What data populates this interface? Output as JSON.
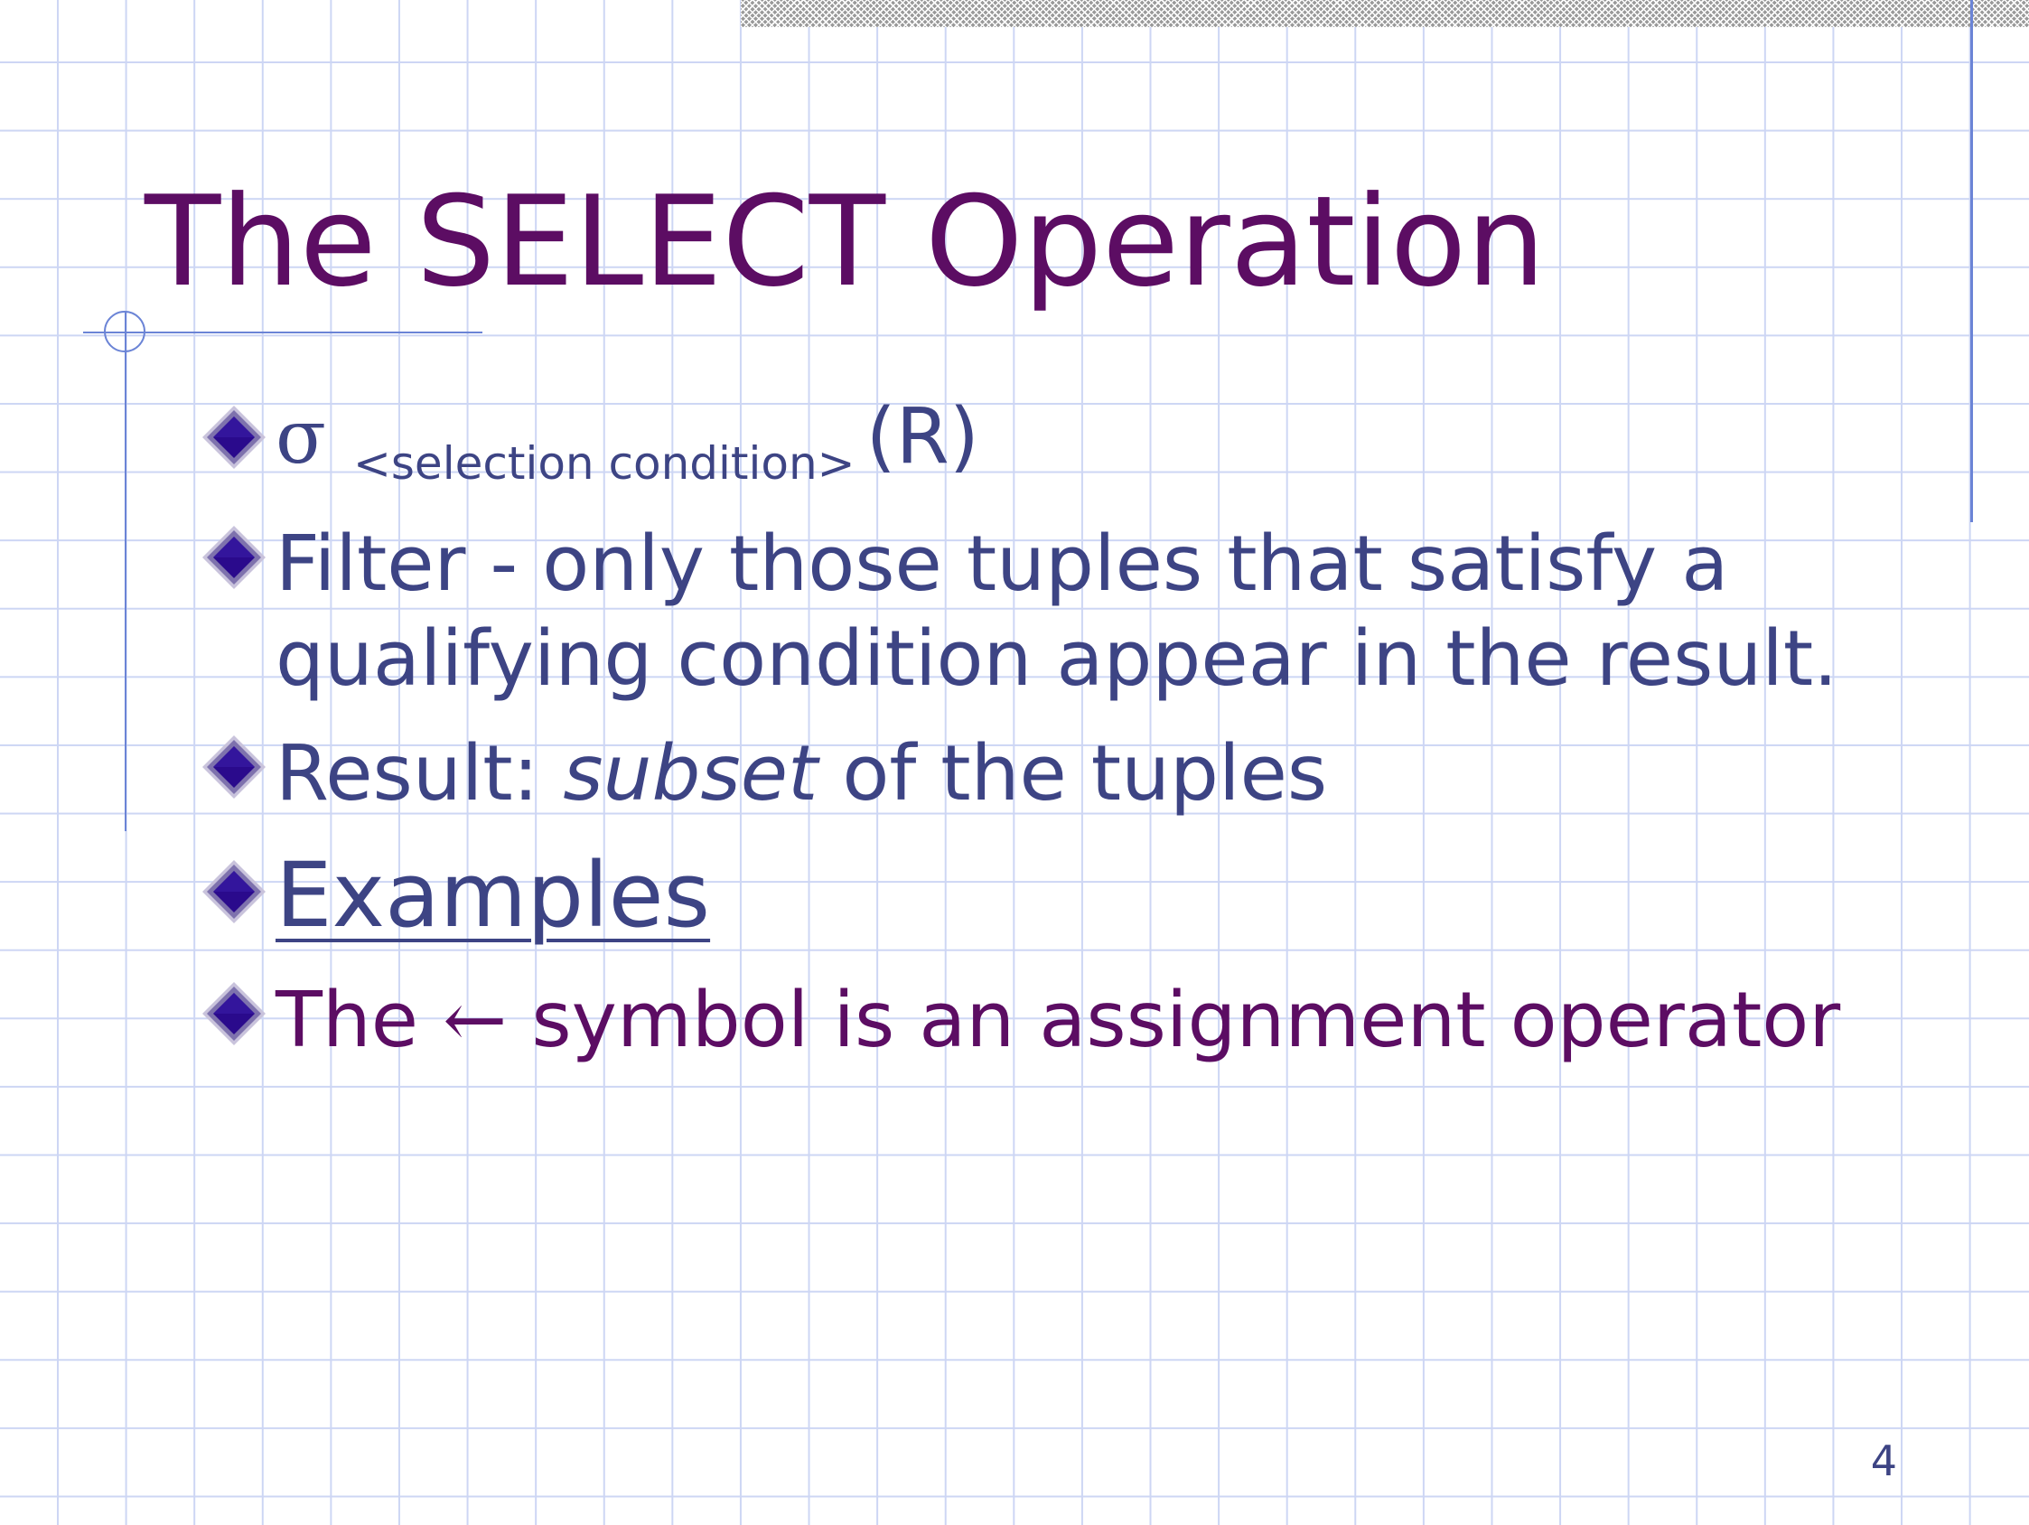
{
  "slide": {
    "title": "The SELECT Operation",
    "bullets": [
      {
        "symbol": "σ",
        "subscript": "<selection condition>",
        "argument": "(R)"
      },
      {
        "line1": "Filter - only those tuples that satisfy a",
        "line2": "qualifying condition appear in the result."
      },
      {
        "prefix": "Result: ",
        "emphasis": "subset",
        "suffix": " of the tuples"
      },
      {
        "link_text": "Examples"
      },
      {
        "prefix": "The ",
        "arrow": "←",
        "suffix": " symbol is an assignment operator"
      }
    ],
    "page_number": "4"
  },
  "colors": {
    "title": "#5c0d63",
    "body_text": "#3d4484",
    "accent_text": "#5c0d63",
    "bullet": "#2a0a8c",
    "grid_line": "#cdd6f4",
    "rule_line": "#6b84d6"
  },
  "icons": {
    "bullet": "diamond-bullet-icon"
  }
}
